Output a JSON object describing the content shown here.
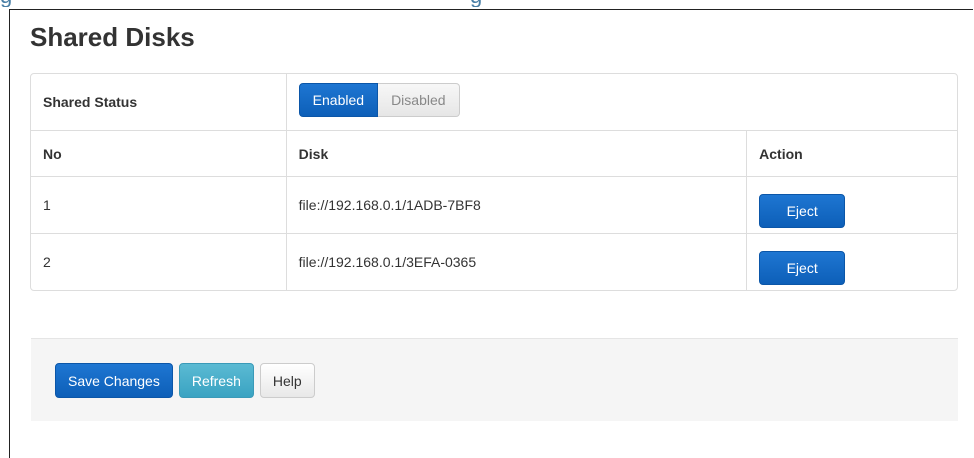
{
  "header_fragment": {
    "left": "g",
    "right": "g"
  },
  "page": {
    "title": "Shared Disks"
  },
  "shared_status": {
    "label": "Shared Status",
    "options": [
      "Enabled",
      "Disabled"
    ],
    "selected": "Enabled"
  },
  "table": {
    "columns": [
      "No",
      "Disk",
      "Action"
    ],
    "rows": [
      {
        "no": "1",
        "disk": "file://192.168.0.1/1ADB-7BF8",
        "action": "Eject"
      },
      {
        "no": "2",
        "disk": "file://192.168.0.1/3EFA-0365",
        "action": "Eject"
      }
    ]
  },
  "footer": {
    "save_label": "Save Changes",
    "refresh_label": "Refresh",
    "help_label": "Help"
  },
  "colors": {
    "primary": "#0d5fb8",
    "info": "#3aa3c2",
    "link": "#4a7fa6"
  }
}
